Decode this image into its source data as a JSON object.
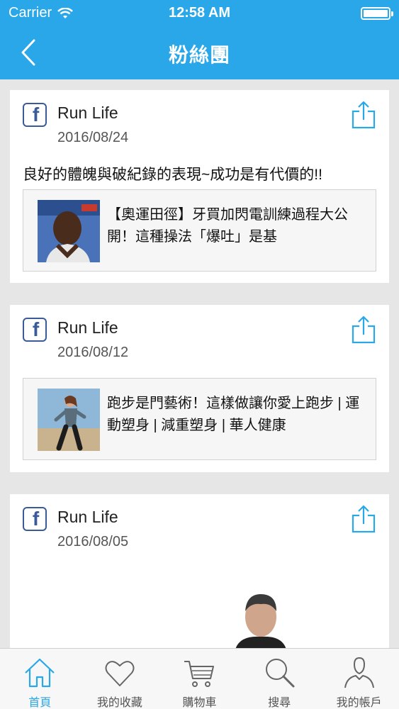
{
  "status_bar": {
    "carrier": "Carrier",
    "time": "12:58 AM"
  },
  "nav": {
    "title": "粉絲團",
    "back_icon": "chevron-left-icon"
  },
  "posts": [
    {
      "source_icon": "facebook-icon",
      "author": "Run Life",
      "date": "2016/08/24",
      "text": "良好的體魄與破紀錄的表現~成功是有代價的!!",
      "link_title": "【奧運田徑】牙買加閃電訓練過程大公開！這種操法「爆吐」是基"
    },
    {
      "source_icon": "facebook-icon",
      "author": "Run Life",
      "date": "2016/08/12",
      "text": "",
      "link_title": "跑步是門藝術！這樣做讓你愛上跑步 | 運動塑身 | 減重塑身 | 華人健康"
    },
    {
      "source_icon": "facebook-icon",
      "author": "Run Life",
      "date": "2016/08/05"
    }
  ],
  "tabs": [
    {
      "label": "首頁",
      "icon": "home-icon",
      "active": true
    },
    {
      "label": "我的收藏",
      "icon": "heart-icon",
      "active": false
    },
    {
      "label": "購物車",
      "icon": "cart-icon",
      "active": false
    },
    {
      "label": "搜尋",
      "icon": "search-icon",
      "active": false
    },
    {
      "label": "我的帳戶",
      "icon": "user-icon",
      "active": false
    }
  ],
  "colors": {
    "accent": "#2aa7e8",
    "facebook": "#3b5a9a",
    "background": "#e6e6e6"
  }
}
